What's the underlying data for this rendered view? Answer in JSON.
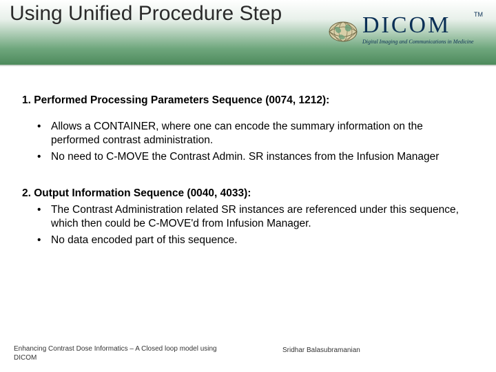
{
  "title": "Using Unified Procedure Step",
  "logo": {
    "main": "DICOM",
    "tm": "TM",
    "sub": "Digital Imaging and Communications in Medicine"
  },
  "section1": {
    "heading": "1. Performed Processing Parameters Sequence (0074, 1212):",
    "bullets": [
      "Allows a CONTAINER, where one can encode the summary information on the performed contrast administration.",
      "No need to C-MOVE the Contrast Admin. SR instances from the Infusion Manager"
    ]
  },
  "section2": {
    "heading": "2. Output Information Sequence (0040, 4033):",
    "bullets": [
      "The Contrast Administration related SR instances are referenced under this sequence, which then could be C-MOVE'd from Infusion Manager.",
      "No data encoded part of this sequence."
    ]
  },
  "footer": {
    "left": "Enhancing Contrast Dose Informatics – A Closed loop model using DICOM",
    "right": "Sridhar Balasubramanian"
  }
}
